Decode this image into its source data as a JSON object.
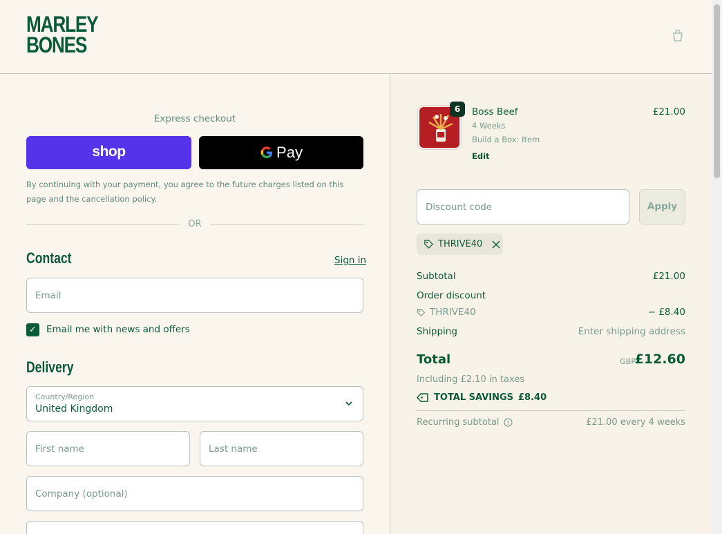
{
  "header": {
    "logo_line1": "MARLEY",
    "logo_line2": "BONES",
    "cart_icon": "cart-icon"
  },
  "express": {
    "label": "Express checkout",
    "shop_pay_label": "shop",
    "gpay_label": "Pay",
    "disclaimer": "By continuing with your payment, you agree to the future charges listed on this page and the cancellation policy.",
    "or_label": "OR"
  },
  "contact": {
    "heading": "Contact",
    "sign_in": "Sign in",
    "email_placeholder": "Email",
    "newsletter_label": "Email me with news and offers",
    "newsletter_checked": true
  },
  "delivery": {
    "heading": "Delivery",
    "country_label": "Country/Region",
    "country_value": "United Kingdom",
    "first_name_placeholder": "First name",
    "last_name_placeholder": "Last name",
    "company_placeholder": "Company (optional)"
  },
  "order": {
    "item": {
      "name": "Boss Beef",
      "quantity": "6",
      "meta1": "4 Weeks",
      "meta2": "Build a Box: Item",
      "edit_label": "Edit",
      "price": "£21.00"
    },
    "discount_placeholder": "Discount code",
    "apply_label": "Apply",
    "applied_code": "THRIVE40",
    "subtotal_label": "Subtotal",
    "subtotal_value": "£21.00",
    "order_discount_label": "Order discount",
    "discount_code_label": "THRIVE40",
    "discount_value": "− £8.40",
    "shipping_label": "Shipping",
    "shipping_value": "Enter shipping address",
    "total_label": "Total",
    "total_currency": "GBP",
    "total_value": "£12.60",
    "taxes": "Including £2.10 in taxes",
    "savings_label": "TOTAL SAVINGS",
    "savings_value": "£8.40",
    "recurring_label": "Recurring subtotal",
    "recurring_value": "£21.00 every 4 weeks"
  },
  "colors": {
    "brand_green": "#0b5a37",
    "shop_pay_purple": "#5433eb",
    "background": "#faf6ee"
  }
}
